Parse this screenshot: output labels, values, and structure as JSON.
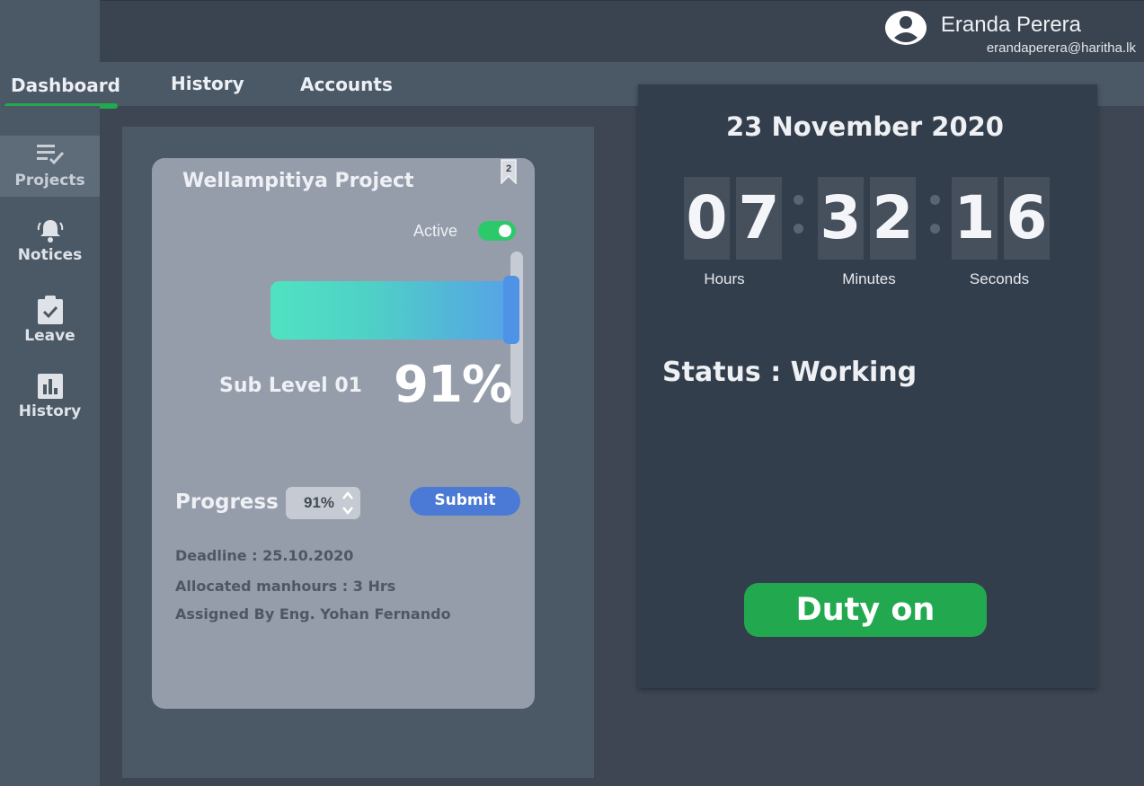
{
  "user": {
    "name": "Eranda Perera",
    "email": "erandaperera@haritha.lk"
  },
  "tabs": [
    {
      "label": "Dashboard",
      "active": true
    },
    {
      "label": "History",
      "active": false
    },
    {
      "label": "Accounts",
      "active": false
    }
  ],
  "sidebar": {
    "items": [
      {
        "label": "Projects",
        "icon": "playlist-check-icon",
        "active": true
      },
      {
        "label": "Notices",
        "icon": "bell-icon",
        "active": false
      },
      {
        "label": "Leave",
        "icon": "clipboard-check-icon",
        "active": false
      },
      {
        "label": "History",
        "icon": "bar-chart-icon",
        "active": false
      }
    ]
  },
  "project": {
    "title": "Wellampitiya Project",
    "bookmark_count": "2",
    "status_label": "Active",
    "status_on": true,
    "sublevel_label": "Sub Level 01",
    "percent": "91%",
    "progress_fraction": 0.91,
    "progress_label": "Progress",
    "stepper_value": "91%",
    "submit_label": "Submit",
    "deadline": "Deadline :  25.10.2020",
    "manhours": "Allocated manhours : 3 Hrs",
    "assigned_by": "Assigned By Eng. Yohan Fernando"
  },
  "clock": {
    "date": "23 November 2020",
    "hours": [
      "0",
      "7"
    ],
    "minutes": [
      "3",
      "2"
    ],
    "seconds": [
      "1",
      "6"
    ],
    "hours_label": "Hours",
    "minutes_label": "Minutes",
    "seconds_label": "Seconds",
    "status": "Status : Working",
    "duty_button": "Duty on"
  },
  "colors": {
    "accent_green": "#22a94f",
    "toggle_green": "#2cc96a",
    "submit_blue": "#4a7ad6",
    "panel_dark": "#333e4c"
  }
}
